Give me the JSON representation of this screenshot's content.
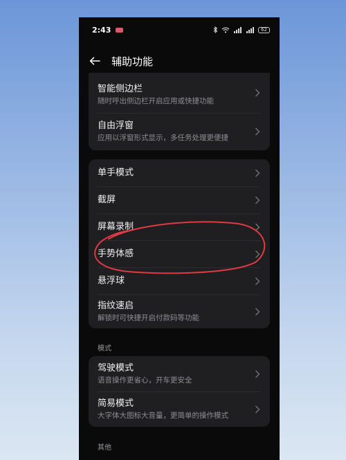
{
  "status_bar": {
    "time": "2:43",
    "battery": "62"
  },
  "header": {
    "title": "辅助功能"
  },
  "group1": {
    "items": [
      {
        "title": "智能侧边栏",
        "subtitle": "随时呼出侧边栏开启应用或快捷功能"
      },
      {
        "title": "自由浮窗",
        "subtitle": "应用以浮窗形式显示，多任务处理更便捷"
      }
    ]
  },
  "group2": {
    "items": [
      {
        "title": "单手模式"
      },
      {
        "title": "截屏"
      },
      {
        "title": "屏幕录制"
      },
      {
        "title": "手势体感"
      },
      {
        "title": "悬浮球"
      },
      {
        "title": "指纹速启",
        "subtitle": "解锁时可快捷开启付款码等功能"
      }
    ]
  },
  "mode_section": {
    "label": "模式",
    "items": [
      {
        "title": "驾驶模式",
        "subtitle": "语音操作更省心，开车更安全"
      },
      {
        "title": "简易模式",
        "subtitle": "大字体大图标大音量，更简单的操作模式"
      }
    ]
  },
  "other_section": {
    "label": "其他"
  },
  "colors": {
    "background": "#0a0a0a",
    "card": "#1f1f21",
    "annotation_stroke": "#e23a45"
  }
}
